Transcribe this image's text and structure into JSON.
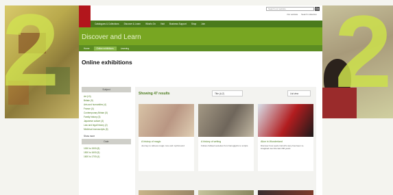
{
  "site": {
    "search": {
      "placeholder": "Search our website",
      "button": "Go"
    },
    "search_options": [
      "Our website",
      "Search collection"
    ]
  },
  "nav": [
    "Catalogues & Collections",
    "Discover & Learn",
    "What's On",
    "Visit",
    "Business Support",
    "Shop",
    "Join"
  ],
  "banner": {
    "title": "Discover and Learn"
  },
  "subnav": [
    {
      "label": "Home",
      "active": false
    },
    {
      "label": "Online exhibitions",
      "active": true
    },
    {
      "label": "Learning",
      "active": false
    }
  ],
  "page_title": "Online exhibitions",
  "sidebar": {
    "subject_header": "Subject",
    "subjects": [
      "Art (13)",
      "Britain (9)",
      "Arts and humanities (4)",
      "France (4)",
      "Contemporary Britain (5)",
      "Family history (3)",
      "Japanese culture (3)",
      "Law and legal history (2)",
      "Medieval manuscripts (5)"
    ],
    "show_more": "Show more",
    "date_header": "Date",
    "dates": [
      "1000 to 1500 (8)",
      "1500 to 1600 (5)",
      "1600 to 1700 (4)"
    ]
  },
  "results": {
    "label": "Showing 47 results",
    "sort": "Title (A-Z)",
    "list_view": "List view"
  },
  "cards": [
    {
      "title": "A history of magic",
      "desc": "Journey to witness magic, lore and myth-bound",
      "colors": [
        "#d8c3a6",
        "#b99683",
        "#e0cfb4"
      ]
    },
    {
      "title": "A history of writing",
      "desc": "Follow civilised societies from hieroglyphs to scripts",
      "colors": [
        "#a39884",
        "#6f665b",
        "#c2b8a3"
      ]
    },
    {
      "title": "Alice in Wonderland",
      "desc": "Discover how Lewis Carroll's story has been re-imagined over the last 150 years",
      "colors": [
        "#d7dfe9",
        "#b21d1f",
        "#1a1a1a"
      ]
    }
  ],
  "more_cards": [
    {
      "colors": [
        "#c9b489",
        "#9a8666"
      ]
    },
    {
      "colors": [
        "#c6c39c",
        "#88855e"
      ]
    },
    {
      "colors": [
        "#3a2c2e",
        "#7c3a2a"
      ]
    }
  ]
}
